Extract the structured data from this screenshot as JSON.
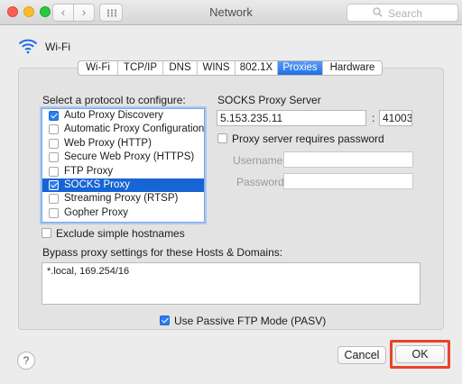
{
  "window": {
    "title": "Network",
    "search_placeholder": "Search",
    "back_glyph": "‹",
    "forward_glyph": "›"
  },
  "interface": {
    "name": "Wi-Fi",
    "icon": "wifi-icon"
  },
  "tabs": [
    {
      "label": "Wi-Fi",
      "active": false
    },
    {
      "label": "TCP/IP",
      "active": false
    },
    {
      "label": "DNS",
      "active": false
    },
    {
      "label": "WINS",
      "active": false
    },
    {
      "label": "802.1X",
      "active": false
    },
    {
      "label": "Proxies",
      "active": true
    },
    {
      "label": "Hardware",
      "active": false
    }
  ],
  "protocols": {
    "heading": "Select a protocol to configure:",
    "items": [
      {
        "label": "Auto Proxy Discovery",
        "checked": true,
        "selected": false
      },
      {
        "label": "Automatic Proxy Configuration",
        "checked": false,
        "selected": false
      },
      {
        "label": "Web Proxy (HTTP)",
        "checked": false,
        "selected": false
      },
      {
        "label": "Secure Web Proxy (HTTPS)",
        "checked": false,
        "selected": false
      },
      {
        "label": "FTP Proxy",
        "checked": false,
        "selected": false
      },
      {
        "label": "SOCKS Proxy",
        "checked": true,
        "selected": true
      },
      {
        "label": "Streaming Proxy (RTSP)",
        "checked": false,
        "selected": false
      },
      {
        "label": "Gopher Proxy",
        "checked": false,
        "selected": false
      }
    ]
  },
  "server": {
    "heading": "SOCKS Proxy Server",
    "host": "5.153.235.11",
    "separator": ":",
    "port": "41003",
    "requires_password_label": "Proxy server requires password",
    "requires_password": false,
    "username_label": "Username:",
    "password_label": "Password:",
    "username": "",
    "password": ""
  },
  "exclude_simple": {
    "label": "Exclude simple hostnames",
    "checked": false
  },
  "bypass": {
    "heading": "Bypass proxy settings for these Hosts & Domains:",
    "value": "*.local, 169.254/16"
  },
  "passive_ftp": {
    "label": "Use Passive FTP Mode (PASV)",
    "checked": true
  },
  "footer": {
    "help": "?",
    "cancel": "Cancel",
    "ok": "OK"
  },
  "colors": {
    "accent": "#1764d4",
    "highlight": "#e8442a"
  }
}
